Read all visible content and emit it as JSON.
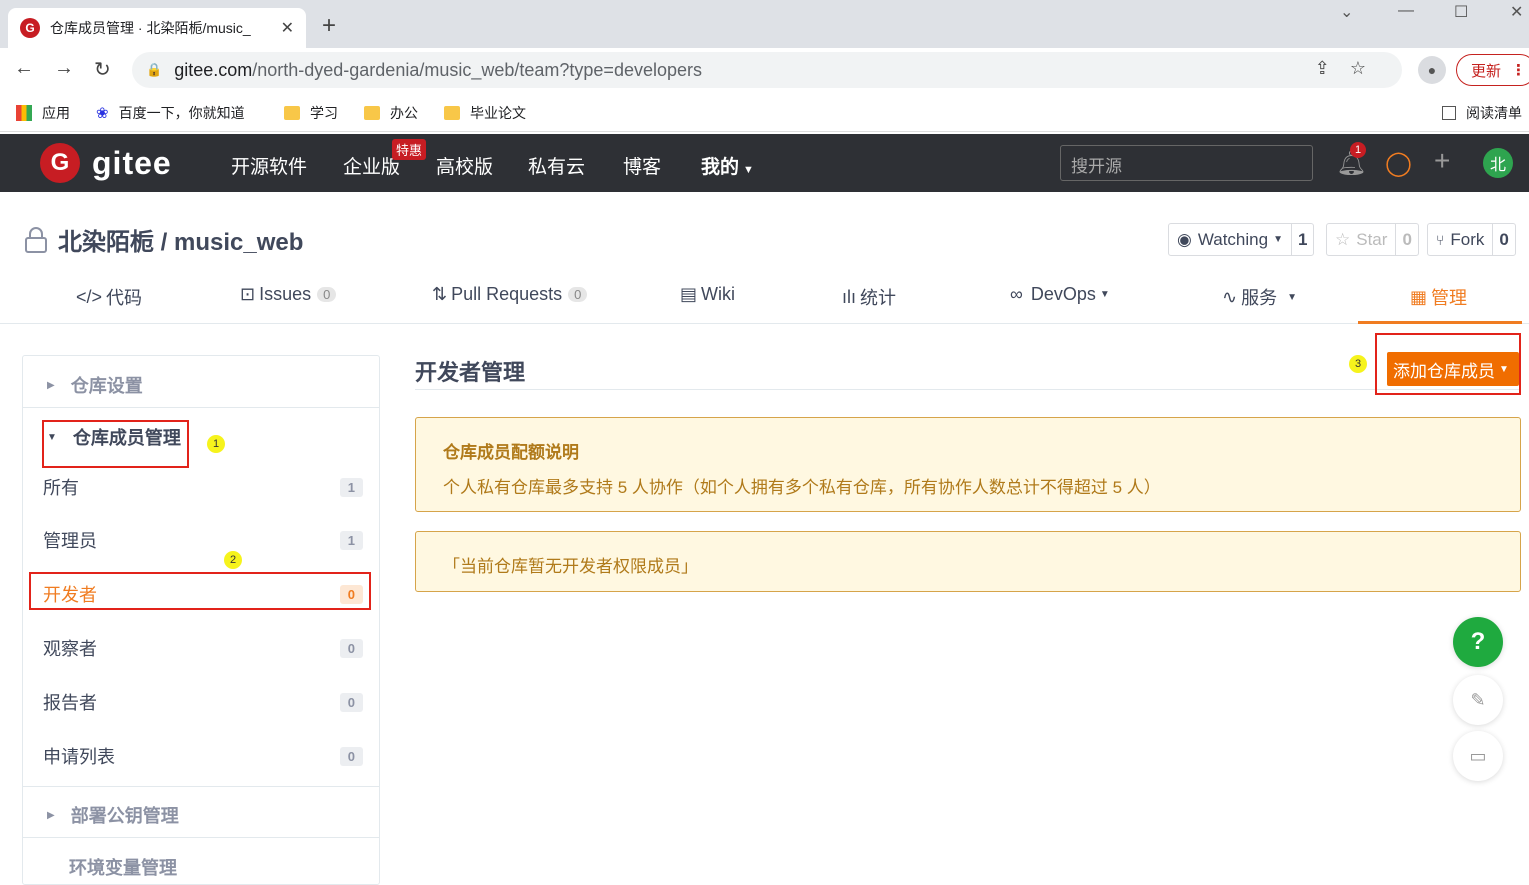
{
  "browser": {
    "tab_title": "仓库成员管理 · 北染陌栀/music_",
    "url_host": "gitee.com",
    "url_path": "/north-dyed-gardenia/music_web/team?type=developers",
    "update_label": "更新",
    "bookmarks": [
      "应用",
      "百度一下，你就知道",
      "学习",
      "办公",
      "毕业论文"
    ],
    "reading_list": "阅读清单"
  },
  "gitee": {
    "logo_text": "gitee",
    "nav": [
      "开源软件",
      "企业版",
      "高校版",
      "私有云",
      "博客",
      "我的"
    ],
    "special_badge": "特惠",
    "search_placeholder": "搜开源",
    "notification_count": "1",
    "avatar_text": "北"
  },
  "repo": {
    "title": "北染陌栀 / music_web",
    "watching_label": "Watching",
    "watching_count": "1",
    "star_label": "Star",
    "star_count": "0",
    "fork_label": "Fork",
    "fork_count": "0",
    "tabs": [
      {
        "label": "代码",
        "icon": "code-icon"
      },
      {
        "label": "Issues",
        "count": "0",
        "icon": "issues-icon"
      },
      {
        "label": "Pull Requests",
        "count": "0",
        "icon": "pull-request-icon"
      },
      {
        "label": "Wiki",
        "icon": "book-icon"
      },
      {
        "label": "统计",
        "icon": "bar-chart-icon"
      },
      {
        "label": "DevOps",
        "icon": "infinity-icon"
      },
      {
        "label": "服务",
        "icon": "pulse-icon"
      },
      {
        "label": "管理",
        "icon": "manage-icon"
      }
    ]
  },
  "sidebar": {
    "repo_settings": "仓库设置",
    "member_mgmt": "仓库成员管理",
    "items": [
      {
        "label": "所有",
        "count": "1"
      },
      {
        "label": "管理员",
        "count": "1"
      },
      {
        "label": "开发者",
        "count": "0"
      },
      {
        "label": "观察者",
        "count": "0"
      },
      {
        "label": "报告者",
        "count": "0"
      },
      {
        "label": "申请列表",
        "count": "0"
      }
    ],
    "deploy_keys": "部署公钥管理",
    "env_vars": "环境变量管理"
  },
  "main": {
    "title": "开发者管理",
    "add_button": "添加仓库成员",
    "quota_title": "仓库成员配额说明",
    "quota_body": "个人私有仓库最多支持 5 人协作（如个人拥有多个私有仓库，所有协作人数总计不得超过 5 人）",
    "empty_text": "「当前仓库暂无开发者权限成员」"
  },
  "annotations": [
    "1",
    "2",
    "3"
  ],
  "float": {
    "help": "?"
  },
  "colors": {
    "accent": "#f07c21",
    "header_bg": "#2e3035",
    "brand_red": "#c71d23",
    "annotation_red": "#e2231a"
  }
}
